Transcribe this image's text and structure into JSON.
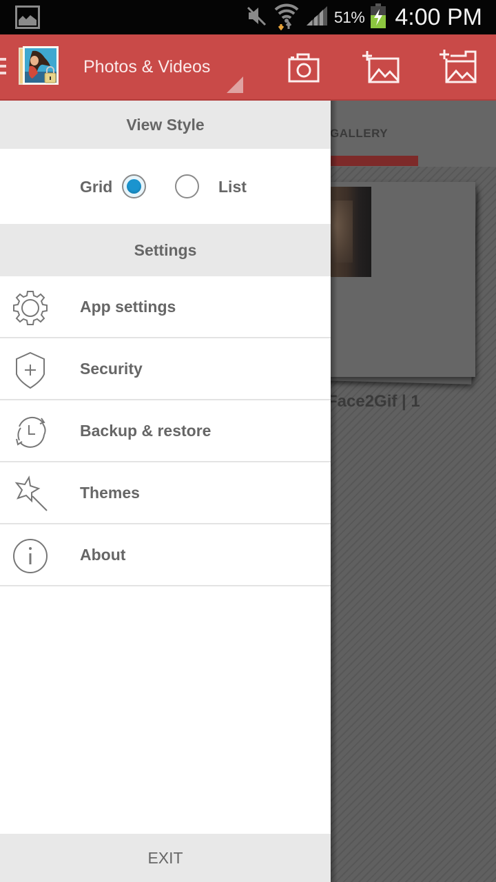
{
  "status_bar": {
    "notification_icon": "image-icon",
    "icons": [
      "mute-icon",
      "wifi-icon",
      "signal-icon",
      "battery-charging-icon"
    ],
    "battery_percent": "51%",
    "time": "4:00 PM",
    "battery_color": "#8cc63f"
  },
  "action_bar": {
    "title": "Photos & Videos",
    "menu_icon": "hamburger-icon",
    "app_icon": "gallery-lock-app-icon",
    "actions": [
      {
        "name": "camera",
        "icon": "camera-icon"
      },
      {
        "name": "add-image",
        "icon": "add-image-icon"
      },
      {
        "name": "add-album",
        "icon": "add-album-icon"
      }
    ],
    "color": "#c94a48"
  },
  "drawer": {
    "view_style": {
      "header": "View Style",
      "options": [
        {
          "label": "Grid",
          "selected": true
        },
        {
          "label": "List",
          "selected": false
        }
      ],
      "radio_color": "#1a94cf"
    },
    "settings": {
      "header": "Settings",
      "items": [
        {
          "label": "App settings",
          "icon": "gear-icon"
        },
        {
          "label": "Security",
          "icon": "shield-plus-icon"
        },
        {
          "label": "Backup & restore",
          "icon": "backup-clock-icon"
        },
        {
          "label": "Themes",
          "icon": "magic-wand-icon"
        },
        {
          "label": "About",
          "icon": "info-icon"
        }
      ]
    },
    "exit_label": "EXIT"
  },
  "background": {
    "tab_label": "GALLERY",
    "album_label": "Face2Gif | 1"
  }
}
